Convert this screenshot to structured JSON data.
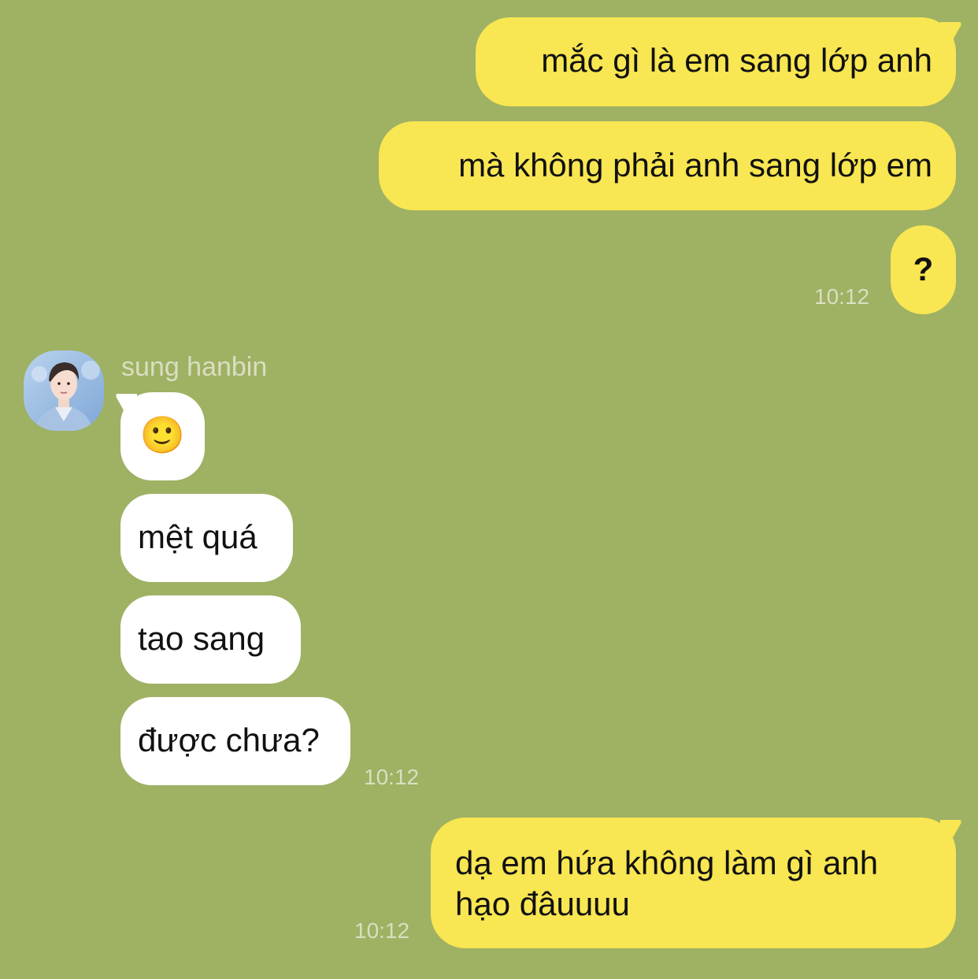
{
  "colors": {
    "background": "#9fb163",
    "outgoing_bubble": "#f8e652",
    "incoming_bubble": "#ffffff",
    "timestamp_text": "#d9dfc1"
  },
  "messages_outgoing_group_1": [
    {
      "text": "mắc gì là em sang lớp anh"
    },
    {
      "text": "mà không phải anh sang lớp em"
    },
    {
      "text": "?"
    }
  ],
  "outgoing_group_1_time": "10:12",
  "incoming": {
    "sender_name": "sung hanbin",
    "avatar_icon": "profile-photo",
    "messages": [
      {
        "text": "🙂"
      },
      {
        "text": "mệt quá"
      },
      {
        "text": "tao sang"
      },
      {
        "text": "được chưa?"
      }
    ],
    "time": "10:12"
  },
  "outgoing_group_2": {
    "lines": [
      "dạ em hứa không làm gì anh",
      "hạo đâuuuu"
    ],
    "time": "10:12"
  }
}
